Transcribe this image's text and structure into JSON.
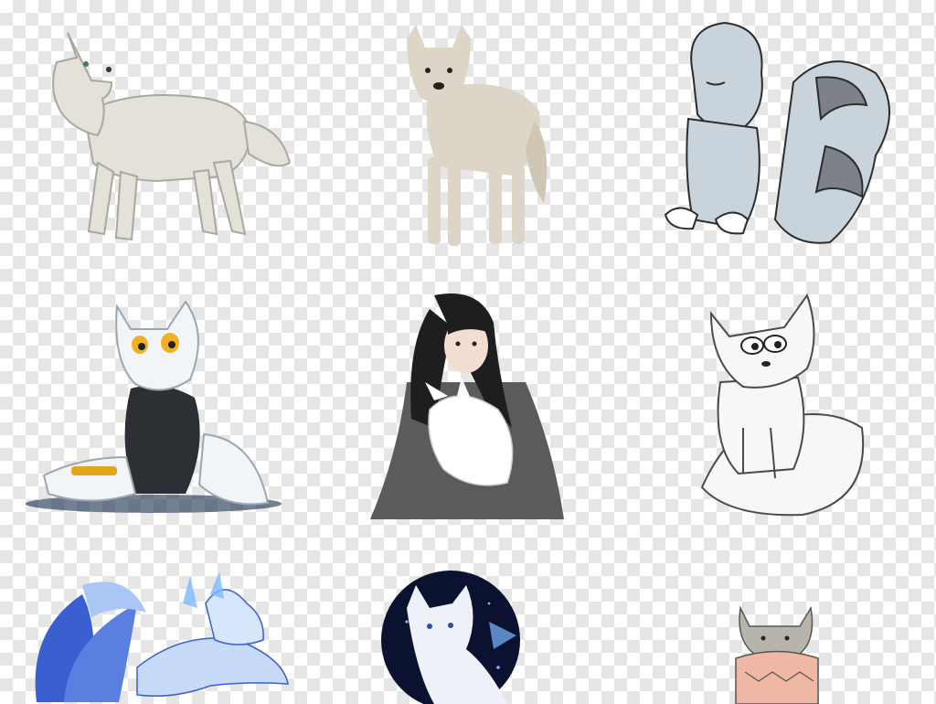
{
  "background": {
    "pattern": "transparency-checkerboard",
    "light": "#ffffff",
    "dark": "#e6e6e6"
  },
  "items": [
    {
      "icon": "wolf-drawing-icon",
      "colors": {
        "fur": "#e4e1d8",
        "outline": "#a9a79f"
      }
    },
    {
      "icon": "white-wolf-photo-icon",
      "colors": {
        "fur": "#ddd6c8",
        "shade": "#b7ab95"
      }
    },
    {
      "icon": "nine-tail-fox-icon",
      "colors": {
        "fur": "#c9d3dc",
        "stripe": "#7d8288",
        "outline": "#2c2c2c"
      }
    },
    {
      "icon": "cartoon-wolf-sitting-icon",
      "colors": {
        "fur": "#f2f5f8",
        "vest": "#2c2f33",
        "eye": "#f0b020",
        "band": "#e3a51a"
      }
    },
    {
      "icon": "woman-holding-fox-icon",
      "colors": {
        "robe": "#5b5b5b",
        "hair": "#1e1e1e",
        "skin": "#f3ddd0",
        "fox": "#ffffff"
      }
    },
    {
      "icon": "arctic-fox-drawing-icon",
      "colors": {
        "fur": "#f7f7fa",
        "outline": "#4a4a4a"
      }
    },
    {
      "icon": "blue-nine-tail-fox-icon",
      "colors": {
        "tail": "#3a5fd0",
        "light": "#a9c6f5",
        "glow": "#7bb9ff"
      }
    },
    {
      "icon": "wolf-circle-night-icon",
      "colors": {
        "circle": "#0b1230",
        "star": "#8fb4ff",
        "fur": "#eef2f8"
      }
    },
    {
      "icon": "fox-sweater-sketch-icon",
      "colors": {
        "fur": "#b8b3ab",
        "sweater": "#f1b7a5",
        "outline": "#555555"
      }
    }
  ]
}
